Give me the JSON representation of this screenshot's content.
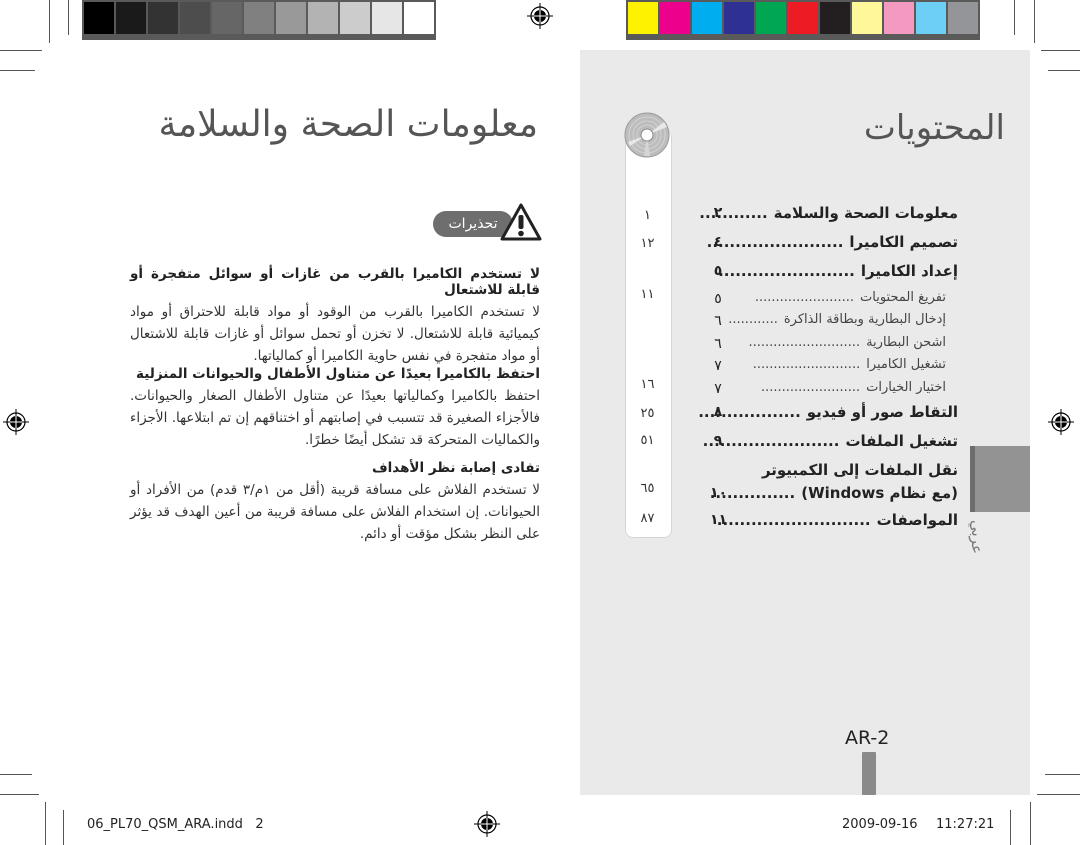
{
  "color_bars": {
    "grayscale": [
      "#000000",
      "#1a1a1a",
      "#333333",
      "#4d4d4d",
      "#666666",
      "#808080",
      "#999999",
      "#b3b3b3",
      "#cccccc",
      "#e6e6e6",
      "#ffffff"
    ],
    "process": [
      "#fff200",
      "#ec008c",
      "#00aeef",
      "#2e3192",
      "#00a651",
      "#ed1c24",
      "#231f20",
      "#fff799",
      "#f49ac1",
      "#6dcff6",
      "#939598"
    ]
  },
  "left_page": {
    "title": "معلومات الصحة والسلامة",
    "warning_badge": "تحذيرات",
    "warning_icon": "warning-triangle-icon",
    "sections": [
      {
        "heading": "لا تستخدم الكاميرا بالقرب من غازات أو سوائل متفجرة أو قابلة للاشتعال",
        "body": "لا تستخدم الكاميرا بالقرب من الوقود أو مواد قابلة للاحتراق أو مواد كيميائية قابلة للاشتعال. لا تخزن أو تحمل سوائل أو غازات قابلة للاشتعال أو مواد متفجرة في نفس حاوية الكاميرا أو كمالياتها."
      },
      {
        "heading": "احتفظ بالكاميرا بعيدًا عن متناول الأطفال والحيوانات المنزلية",
        "body": "احتفظ بالكاميرا وكمالياتها بعيدًا عن متناول الأطفال الصغار والحيوانات. فالأجزاء الصغيرة قد تتسبب في إصابتهم أو اختناقهم إن تم ابتلاعها. الأجزاء والكماليات المتحركة قد تشكل أيضًا خطرًا."
      },
      {
        "heading": "تفادى إصابة نظر الأهداف",
        "body": "لا تستخدم الفلاش على مسافة قريبة (أقل من ١م/٣ قدم) من الأفراد أو الحيوانات. إن استخدام الفلاش على مسافة قريبة من أعين الهدف قد يؤثر على النظر بشكل مؤقت أو دائم."
      }
    ]
  },
  "right_page": {
    "title": "المحتويات",
    "title_icon": "cd-disc-icon",
    "toc": [
      {
        "label": "معلومات الصحة والسلامة",
        "dots": "............",
        "page": "٢",
        "bold": true
      },
      {
        "label": "تصميم الكاميرا",
        "dots": "........................",
        "page": "٤",
        "bold": true
      },
      {
        "label": "إعداد الكاميرا",
        "dots": "........................",
        "page": "٥",
        "bold": true
      },
      {
        "label": "تفريغ المحتويات",
        "dots": "........................",
        "page": "٥",
        "bold": false
      },
      {
        "label": "إدخال البطارية وبطاقة الذاكرة",
        "dots": "............",
        "page": "٦",
        "bold": false
      },
      {
        "label": "اشحن البطارية",
        "dots": "...........................",
        "page": "٦",
        "bold": false
      },
      {
        "label": "تشغيل الكاميرا",
        "dots": "..........................",
        "page": "٧",
        "bold": false
      },
      {
        "label": "اختيار الخيارات",
        "dots": "........................",
        "page": "٧",
        "bold": false
      },
      {
        "label": "التقاط صور أو فيديو",
        "dots": "..................",
        "page": "٨",
        "bold": true
      },
      {
        "label": "تشغيل الملفات",
        "dots": "........................",
        "page": "٩",
        "bold": true
      },
      {
        "label": "نقل الملفات إلى الكمبيوتر",
        "dots": "",
        "page": "",
        "bold": true
      },
      {
        "label": "(مع نظام Windows)",
        "dots": "...............",
        "page": "١٠",
        "bold": true
      },
      {
        "label": "المواصفات",
        "dots": "...........................",
        "page": "١١",
        "bold": true
      }
    ],
    "strip_numbers": [
      "١",
      "١٢",
      "١١",
      "١٦",
      "٢٥",
      "٥١",
      "٦٥",
      "٨٧"
    ],
    "side_tab_label": "عربي",
    "page_number": "AR-2"
  },
  "footer": {
    "file_name": "06_PL70_QSM_ARA.indd   2",
    "date": "2009-09-16",
    "time": "11:27:21"
  }
}
